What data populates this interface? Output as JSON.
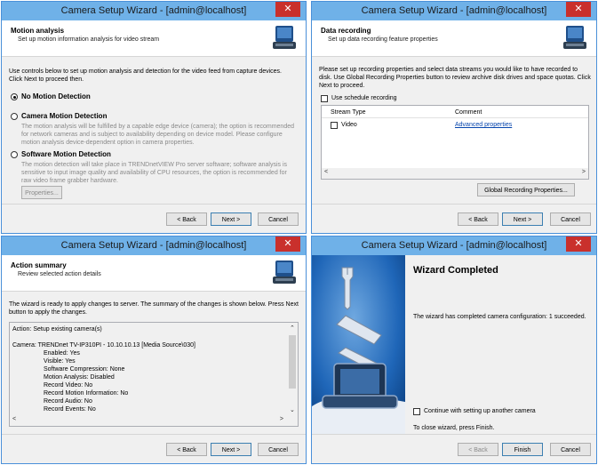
{
  "w1": {
    "title": "Camera Setup Wizard - [admin@localhost]",
    "close": "✕",
    "header_title": "Motion analysis",
    "header_sub": "Set up motion information analysis for video stream",
    "intro": "Use controls below to set up motion analysis and detection for the video feed from capture devices. Click Next to proceed then.",
    "opt1": "No Motion Detection",
    "opt2": "Camera Motion Detection",
    "opt2_desc": "The motion analysis will be fulfilled by a capable edge device (camera); the option is recommended for network cameras and is subject to availability depending on device model. Please configure motion analysis device-dependent option in camera properties.",
    "opt3": "Software Motion Detection",
    "opt3_desc": "The motion detection will take place in TRENDnetVIEW Pro server software; software analysis is sensitive to input image quality and availability of CPU resources, the option is recommended for raw video frame grabber hardware.",
    "properties": "Properties...",
    "back": "< Back",
    "next": "Next >",
    "cancel": "Cancel"
  },
  "w2": {
    "title": "Camera Setup Wizard - [admin@localhost]",
    "close": "✕",
    "header_title": "Data recording",
    "header_sub": "Set up data recording feature properties",
    "intro": "Please set up recording properties and select data streams you would like to have recorded to disk. Use Global Recording Properties button to review archive disk drives and space quotas. Click Next to proceed.",
    "schedule": "Use schedule recording",
    "col1": "Stream Type",
    "col2": "Comment",
    "row_type": "Video",
    "row_link": "Advanced properties",
    "global_btn": "Global Recording Properties...",
    "back": "< Back",
    "next": "Next >",
    "cancel": "Cancel"
  },
  "w3": {
    "title": "Camera Setup Wizard - [admin@localhost]",
    "close": "✕",
    "header_title": "Action summary",
    "header_sub": "Review selected action details",
    "intro": "The wizard is ready to apply changes to server. The summary of the changes is shown below. Press Next button to apply the changes.",
    "summary": [
      "Action: Setup existing camera(s)",
      "",
      "Camera: TRENDnet TV-IP310PI - 10.10.10.13 [Media Source\\030]",
      "Enabled: Yes",
      "Visible: Yes",
      "Software Compression: None",
      "Motion Analysis: Disabled",
      "Record Video: No",
      "Record Motion Information: No",
      "Record Audio: No",
      "Record Events: No"
    ],
    "back": "< Back",
    "next": "Next >",
    "cancel": "Cancel"
  },
  "w4": {
    "title": "Camera Setup Wizard - [admin@localhost]",
    "close": "✕",
    "heading": "Wizard Completed",
    "msg": "The wizard has completed camera configuration: 1 succeeded.",
    "continue": "Continue with setting up another camera",
    "close_msg": "To close wizard, press Finish.",
    "back": "< Back",
    "finish": "Finish",
    "cancel": "Cancel"
  },
  "colors": {
    "titlebar": "#6fb1e8",
    "close": "#c9302c",
    "banner": "#0a5aa8"
  }
}
